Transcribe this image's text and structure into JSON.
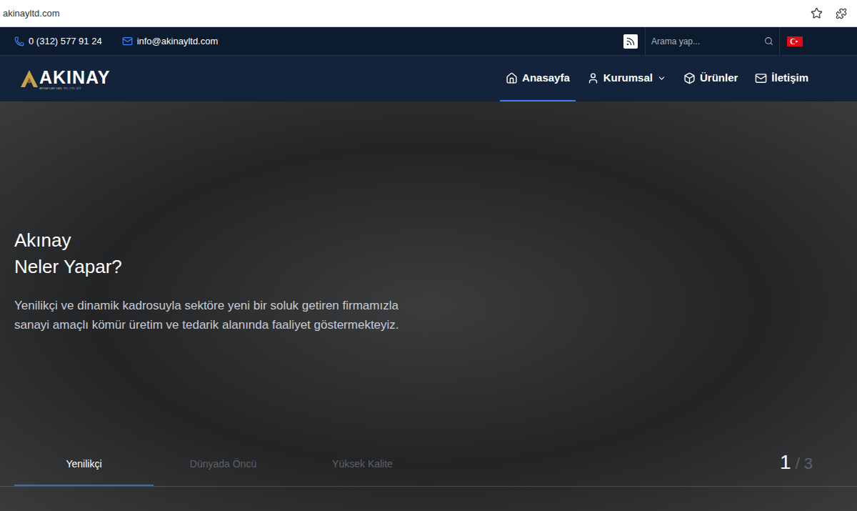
{
  "browser": {
    "url": "akinayltd.com"
  },
  "topbar": {
    "phone": "0 (312) 577 91 24",
    "email": "info@akinayltd.com",
    "search": {
      "placeholder": "Arama yap..."
    }
  },
  "logo": {
    "name": "AKINAY",
    "subtitle": "AKINAYLAR SAN. TİC. LTD. ŞTİ."
  },
  "nav": [
    {
      "label": "Anasayfa",
      "selected": true,
      "dropdown": false,
      "kind": "home"
    },
    {
      "label": "Kurumsal",
      "selected": false,
      "dropdown": true,
      "kind": "user"
    },
    {
      "label": "Ürünler",
      "selected": false,
      "dropdown": false,
      "kind": "box"
    },
    {
      "label": "İletişim",
      "selected": false,
      "dropdown": false,
      "kind": "mail"
    }
  ],
  "hero": {
    "title": [
      "Akınay",
      "Neler Yapar?"
    ],
    "text": [
      "Yenilikçi ve dinamik kadrosuyla sektöre yeni bir soluk getiren firmamızla",
      "sanayi amaçlı kömür üretim ve tedarik alanında faaliyet göstermekteyiz."
    ]
  },
  "slides": [
    {
      "label": "Yenilikçi",
      "selected": true
    },
    {
      "label": "Dünyada Öncü",
      "selected": false
    },
    {
      "label": "Yüksek Kalite",
      "selected": false
    }
  ],
  "counter": {
    "current": "1",
    "separator": "/",
    "total": "3"
  }
}
